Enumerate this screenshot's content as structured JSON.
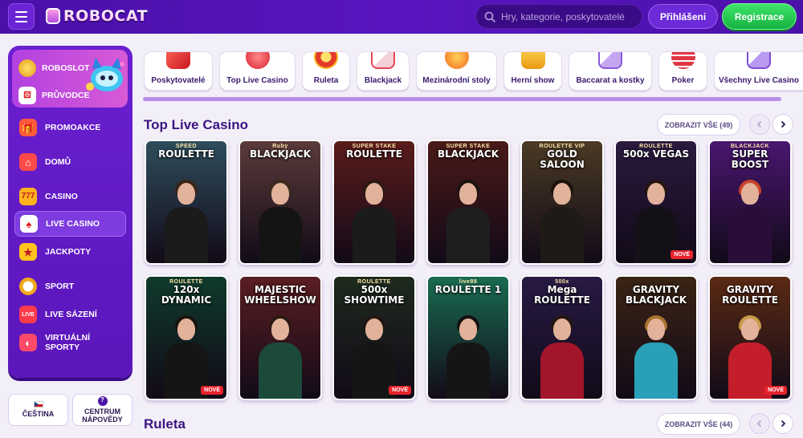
{
  "header": {
    "logo_text": "ROBOCAT",
    "search_placeholder": "Hry, kategorie, poskytovatelé",
    "login_label": "Přihlášeni",
    "register_label": "Registrace"
  },
  "sidebar": {
    "promo": [
      {
        "label": "ROBOSLOT",
        "icon": "coin-icon"
      },
      {
        "label": "PRŮVODCE",
        "icon": "dice-icon"
      }
    ],
    "items": [
      {
        "label": "PROMOAKCE",
        "icon": "gift-icon"
      },
      {
        "label": "DOMŮ",
        "icon": "home-icon"
      },
      {
        "label": "CASINO",
        "icon": "slot-icon"
      },
      {
        "label": "LIVE CASINO",
        "icon": "cards-icon",
        "active": true
      },
      {
        "label": "JACKPOTY",
        "icon": "jackpot-icon"
      },
      {
        "label": "SPORT",
        "icon": "ball-icon"
      },
      {
        "label": "LIVE SÁZENÍ",
        "icon": "live-icon"
      },
      {
        "label": "VIRTUÁLNÍ SPORTY",
        "icon": "vr-icon"
      }
    ],
    "language_label": "ČEŠTINA",
    "help_label_1": "CENTRUM",
    "help_label_2": "NÁPOVĚDY"
  },
  "categories": [
    {
      "label": "Poskytovatelé",
      "icon": "providers-icon",
      "color": "#e8322f"
    },
    {
      "label": "Top Live Casino",
      "icon": "top-live-icon",
      "color": "#ee3a4a"
    },
    {
      "label": "Ruleta",
      "icon": "roulette-icon",
      "color": "#f6b21b"
    },
    {
      "label": "Blackjack",
      "icon": "blackjack-icon",
      "color": "#e84458"
    },
    {
      "label": "Mezinárodní stoly",
      "icon": "globe-icon",
      "color": "#f28a1c"
    },
    {
      "label": "Herní show",
      "icon": "game-show-icon",
      "color": "#f4a81e"
    },
    {
      "label": "Baccarat a kostky",
      "icon": "baccarat-icon",
      "color": "#8a5ad8"
    },
    {
      "label": "Poker",
      "icon": "poker-chips-icon",
      "color": "#e03644"
    },
    {
      "label": "Všechny Live Casino",
      "icon": "all-live-icon",
      "color": "#7c4fd4"
    }
  ],
  "sections": [
    {
      "title": "Top Live Casino",
      "show_all": "ZOBRAZIT VŠE (49)"
    },
    {
      "title": "Ruleta",
      "show_all": "ZOBRAZIT VŠE (44)"
    }
  ],
  "games_row1": [
    {
      "title": "ROULETTE",
      "sub": "SPEED",
      "bg": "#2f4d5c",
      "body": "#1b1b1b",
      "hair": "#3a2418",
      "new": false
    },
    {
      "title": "BLACKJACK",
      "sub": "Ruby",
      "bg": "#5b3b3a",
      "body": "#141414",
      "hair": "#3b2a1e",
      "new": false
    },
    {
      "title": "ROULETTE",
      "sub": "SUPER STAKE",
      "bg": "#5a1b1b",
      "body": "#1b1b1b",
      "hair": "#2b1a12",
      "new": false
    },
    {
      "title": "BLACKJACK",
      "sub": "SUPER STAKE",
      "bg": "#4a1a18",
      "body": "#1e1e1e",
      "hair": "#1a1410",
      "new": false
    },
    {
      "title": "GOLD SALOON",
      "sub": "ROULETTE VIP",
      "bg": "#4a3a24",
      "body": "#1e1a16",
      "hair": "#1b120c",
      "new": false
    },
    {
      "title": "500x VEGAS",
      "sub": "ROULETTE",
      "bg": "#2a1a3e",
      "body": "#141018",
      "hair": "#231510",
      "new": true
    },
    {
      "title": "SUPER BOOST",
      "sub": "BLACKJACK",
      "bg": "#4a1670",
      "body": "#2a0e3a",
      "hair": "#c8442a",
      "new": false
    }
  ],
  "games_row2": [
    {
      "title": "120x DYNAMIC",
      "sub": "ROULETTE",
      "bg": "#0f3a2c",
      "body": "#151515",
      "hair": "#1b120c",
      "new": true
    },
    {
      "title": "MAJESTIC WHEELSHOW",
      "sub": "",
      "bg": "#5a1e22",
      "body": "#1b4a3a",
      "hair": "#2a1a12",
      "new": false
    },
    {
      "title": "500x SHOWTIME",
      "sub": "ROULETTE",
      "bg": "#1e2a1e",
      "body": "#151515",
      "hair": "#231510",
      "new": true
    },
    {
      "title": "ROULETTE 1",
      "sub": "live88",
      "bg": "#1a6b52",
      "body": "#151515",
      "hair": "#151010",
      "new": false
    },
    {
      "title": "Mega ROULETTE",
      "sub": "500x",
      "bg": "#281a44",
      "body": "#a3152a",
      "hair": "#231510",
      "new": false
    },
    {
      "title": "GRAVITY BLACKJACK",
      "sub": "",
      "bg": "#3a2414",
      "body": "#2aa0b8",
      "hair": "#a8722e",
      "new": false
    },
    {
      "title": "GRAVITY ROULETTE",
      "sub": "",
      "bg": "#5a2a14",
      "body": "#c41e2a",
      "hair": "#c79a4a",
      "new": true
    }
  ],
  "new_badge_label": "NOVÉ",
  "colors": {
    "header_bg": "#4a10a8",
    "accent_green": "#15b23f",
    "sidebar_bg": "#6a1fd0",
    "title_color": "#3b1480"
  }
}
